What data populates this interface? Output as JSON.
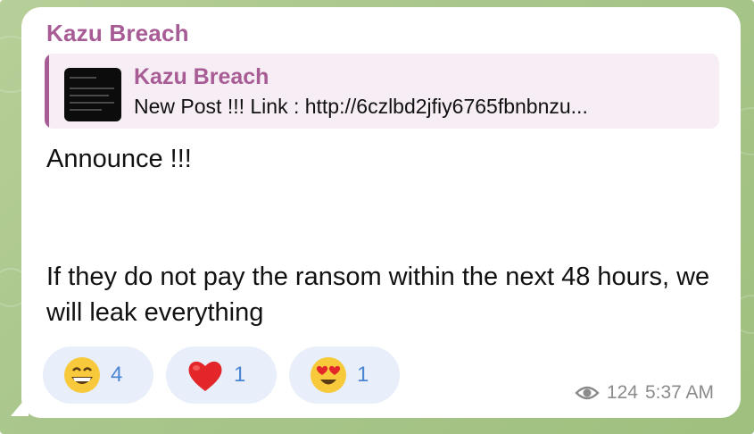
{
  "message": {
    "sender": "Kazu Breach",
    "reply": {
      "title": "Kazu Breach",
      "text": "New Post !!! Link : http://6czlbd2jfiy6765fbnbnzu..."
    },
    "lines": {
      "announce": "Announce !!!",
      "warning": "If they do not pay the ransom within the next 48 hours, we will leak everything"
    },
    "reactions": [
      {
        "icon": "grinning-face-icon",
        "count": "4"
      },
      {
        "icon": "red-heart-icon",
        "count": "1"
      },
      {
        "icon": "heart-eyes-face-icon",
        "count": "1"
      }
    ],
    "views": "124",
    "time": "5:37 AM"
  },
  "colors": {
    "accent": "#a85c95",
    "reaction_bg": "#e8effa",
    "reaction_count": "#4a86d4",
    "chat_bg": "#a9c68c"
  }
}
